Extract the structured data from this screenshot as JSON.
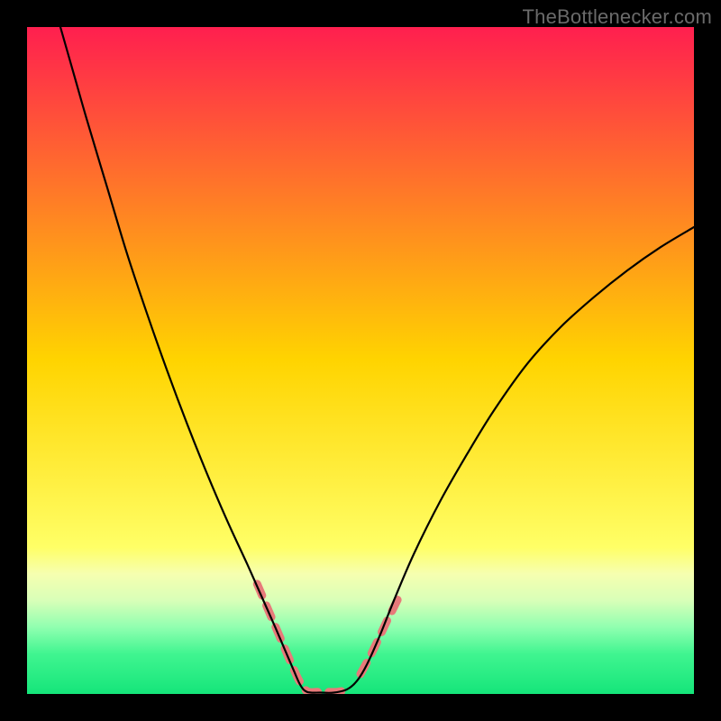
{
  "watermark": "TheBottlenecker.com",
  "chart_data": {
    "type": "line",
    "title": "",
    "xlabel": "",
    "ylabel": "",
    "xlim": [
      0,
      100
    ],
    "ylim": [
      0,
      100
    ],
    "background_gradient": {
      "stops": [
        {
          "offset": 0.0,
          "color": "#ff1f4f"
        },
        {
          "offset": 0.5,
          "color": "#ffd400"
        },
        {
          "offset": 0.78,
          "color": "#ffff66"
        },
        {
          "offset": 0.82,
          "color": "#f6ffb0"
        },
        {
          "offset": 0.86,
          "color": "#d8ffb8"
        },
        {
          "offset": 0.9,
          "color": "#90ffb0"
        },
        {
          "offset": 0.94,
          "color": "#40f590"
        },
        {
          "offset": 1.0,
          "color": "#15e57a"
        }
      ]
    },
    "series": [
      {
        "name": "left-curve",
        "stroke": "#000000",
        "width": 2.2,
        "points": [
          {
            "x": 5.0,
            "y": 100.0
          },
          {
            "x": 7.0,
            "y": 93.0
          },
          {
            "x": 9.0,
            "y": 86.0
          },
          {
            "x": 12.0,
            "y": 76.0
          },
          {
            "x": 15.0,
            "y": 66.0
          },
          {
            "x": 18.0,
            "y": 57.0
          },
          {
            "x": 21.0,
            "y": 48.5
          },
          {
            "x": 24.0,
            "y": 40.5
          },
          {
            "x": 27.0,
            "y": 33.0
          },
          {
            "x": 30.0,
            "y": 26.0
          },
          {
            "x": 33.0,
            "y": 19.5
          },
          {
            "x": 35.0,
            "y": 15.0
          },
          {
            "x": 37.0,
            "y": 10.5
          },
          {
            "x": 38.5,
            "y": 7.0
          },
          {
            "x": 40.0,
            "y": 3.5
          },
          {
            "x": 41.0,
            "y": 1.3
          },
          {
            "x": 42.0,
            "y": 0.3
          },
          {
            "x": 44.0,
            "y": 0.2
          },
          {
            "x": 46.0,
            "y": 0.2
          },
          {
            "x": 48.0,
            "y": 0.7
          },
          {
            "x": 49.5,
            "y": 2.0
          },
          {
            "x": 51.0,
            "y": 4.5
          },
          {
            "x": 53.0,
            "y": 9.0
          },
          {
            "x": 55.0,
            "y": 14.0
          },
          {
            "x": 58.0,
            "y": 21.0
          },
          {
            "x": 62.0,
            "y": 29.0
          },
          {
            "x": 66.0,
            "y": 36.0
          },
          {
            "x": 70.0,
            "y": 42.5
          },
          {
            "x": 75.0,
            "y": 49.5
          },
          {
            "x": 80.0,
            "y": 55.0
          },
          {
            "x": 85.0,
            "y": 59.5
          },
          {
            "x": 90.0,
            "y": 63.5
          },
          {
            "x": 95.0,
            "y": 67.0
          },
          {
            "x": 100.0,
            "y": 70.0
          }
        ]
      }
    ],
    "markers": [
      {
        "name": "left-dash-segment",
        "color": "#e77a7a",
        "width": 9,
        "points": [
          {
            "x": 34.5,
            "y": 16.5
          },
          {
            "x": 36.0,
            "y": 13.0
          },
          {
            "x": 37.2,
            "y": 10.2
          },
          {
            "x": 38.4,
            "y": 7.4
          },
          {
            "x": 39.6,
            "y": 4.6
          },
          {
            "x": 40.8,
            "y": 2.0
          },
          {
            "x": 42.0,
            "y": 0.4
          },
          {
            "x": 43.5,
            "y": 0.3
          },
          {
            "x": 45.0,
            "y": 0.3
          },
          {
            "x": 46.5,
            "y": 0.3
          },
          {
            "x": 47.5,
            "y": 0.5
          }
        ]
      },
      {
        "name": "right-dash-segment",
        "color": "#e77a7a",
        "width": 9,
        "points": [
          {
            "x": 50.0,
            "y": 3.0
          },
          {
            "x": 51.2,
            "y": 5.2
          },
          {
            "x": 52.4,
            "y": 7.6
          },
          {
            "x": 53.8,
            "y": 10.6
          },
          {
            "x": 55.0,
            "y": 13.0
          },
          {
            "x": 56.0,
            "y": 15.0
          }
        ]
      }
    ]
  }
}
